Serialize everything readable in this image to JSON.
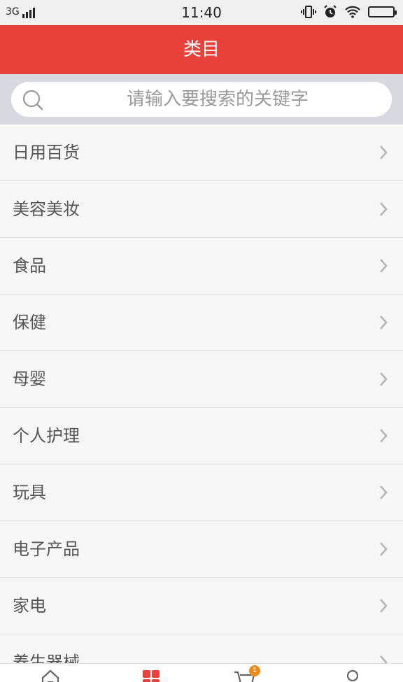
{
  "status_bar": {
    "network": "3G",
    "time": "11:40"
  },
  "header": {
    "title": "类目"
  },
  "search": {
    "placeholder": "请输入要搜索的关键字"
  },
  "categories": [
    {
      "label": "日用百货"
    },
    {
      "label": "美容美妆"
    },
    {
      "label": "食品"
    },
    {
      "label": "保健"
    },
    {
      "label": "母婴"
    },
    {
      "label": "个人护理"
    },
    {
      "label": "玩具"
    },
    {
      "label": "电子产品"
    },
    {
      "label": "家电"
    },
    {
      "label": "养生器械"
    }
  ],
  "tabbar": {
    "tabs": [
      {
        "icon": "home-icon"
      },
      {
        "icon": "category-grid-icon",
        "active": true
      },
      {
        "icon": "cart-icon",
        "badge": "1"
      },
      {
        "icon": "user-icon"
      }
    ]
  },
  "colors": {
    "accent": "#e8403b",
    "badge": "#f08a1c",
    "text": "#555555",
    "search_bg": "#d8d8e0"
  }
}
